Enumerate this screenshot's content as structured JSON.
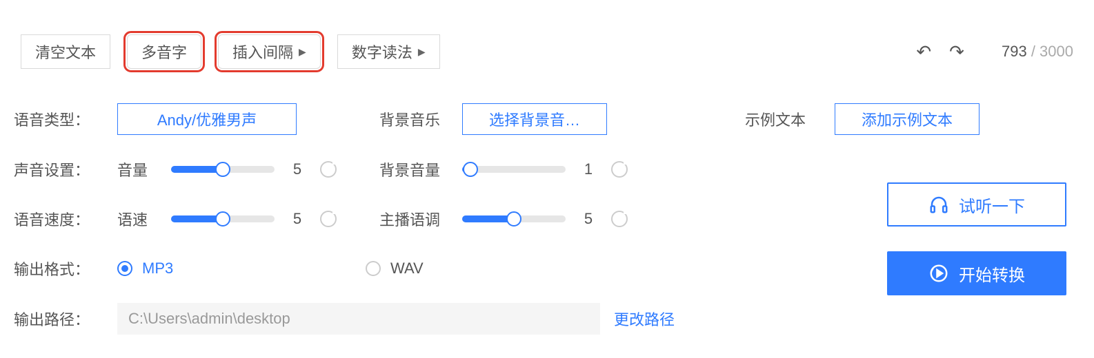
{
  "toolbar": {
    "clear": "清空文本",
    "polyphonic": "多音字",
    "insert_gap": "插入间隔",
    "number_reading": "数字读法",
    "char_count": "793",
    "char_limit": "3000"
  },
  "voice_type": {
    "label": "语音类型：",
    "value": "Andy/优雅男声"
  },
  "bg_music": {
    "label": "背景音乐",
    "value": "选择背景音…"
  },
  "example_text": {
    "label": "示例文本",
    "value": "添加示例文本"
  },
  "sound_settings": {
    "label": "声音设置：",
    "volume_label": "音量",
    "volume_value": "5",
    "bg_volume_label": "背景音量",
    "bg_volume_value": "1"
  },
  "speed_settings": {
    "label": "语音速度：",
    "speed_label": "语速",
    "speed_value": "5",
    "tone_label": "主播语调",
    "tone_value": "5"
  },
  "output_format": {
    "label": "输出格式：",
    "mp3": "MP3",
    "wav": "WAV"
  },
  "output_path": {
    "label": "输出路径：",
    "value": "C:\\Users\\admin\\desktop",
    "change": "更改路径"
  },
  "actions": {
    "preview": "试听一下",
    "convert": "开始转换"
  }
}
